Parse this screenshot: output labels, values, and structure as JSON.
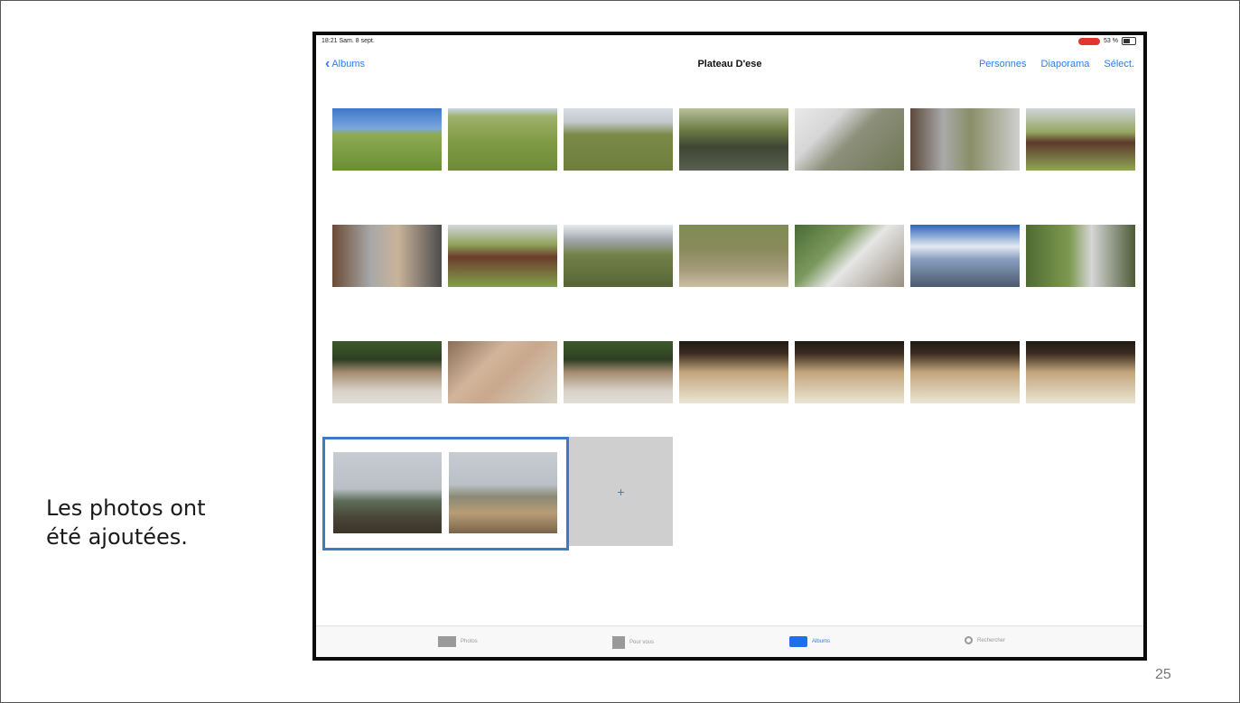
{
  "slide": {
    "caption_line1": "Les photos ont",
    "caption_line2": "été ajoutées.",
    "page_number": "25"
  },
  "status_bar": {
    "time": "18:21 Sam. 8 sept.",
    "battery": "53 %"
  },
  "nav": {
    "back_label": "Albums",
    "title": "Plateau D'ese",
    "people_label": "Personnes",
    "slideshow_label": "Diaporama",
    "select_label": "Sélect."
  },
  "grid": {
    "add_symbol": "+"
  },
  "tabbar": {
    "photos": "Photos",
    "for_you": "Pour vous",
    "albums": "Albums",
    "search": "Rechercher"
  },
  "colors": {
    "accent": "#2f7cf6",
    "selection_border": "#3f79c3",
    "add_tile_bg": "#cfcfcf"
  }
}
